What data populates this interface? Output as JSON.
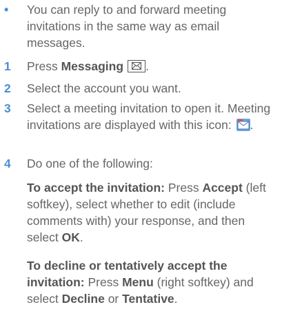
{
  "bullet": {
    "symbol": "•",
    "text": "You can reply to and forward meeting invitations in the same way as email messages."
  },
  "steps": [
    {
      "num": "1",
      "pre": "Press ",
      "bold": "Messaging",
      "post": "."
    },
    {
      "num": "2",
      "text": "Select the account you want."
    },
    {
      "num": "3",
      "text": "Select a meeting invitation to open it. Meeting invitations are displayed with this icon:",
      "post": "."
    },
    {
      "num": "4",
      "text": "Do one of the following:"
    }
  ],
  "accept": {
    "lead": "To accept the invitation:",
    "t1": " Press ",
    "b1": "Accept",
    "t2": " (left softkey), select whether to edit (include comments with) your response, and then select ",
    "b2": "OK",
    "t3": "."
  },
  "decline": {
    "lead": "To decline or tentatively accept the invitation:",
    "t1": " Press ",
    "b1": "Menu",
    "t2": " (right softkey) and select ",
    "b2": "Decline",
    "t3": " or ",
    "b3": "Tentative",
    "t4": "."
  },
  "colors": {
    "accent": "#4a8ed6",
    "text": "#666666"
  },
  "icons": {
    "messaging": "envelope-icon",
    "meeting": "meeting-invitation-icon"
  }
}
